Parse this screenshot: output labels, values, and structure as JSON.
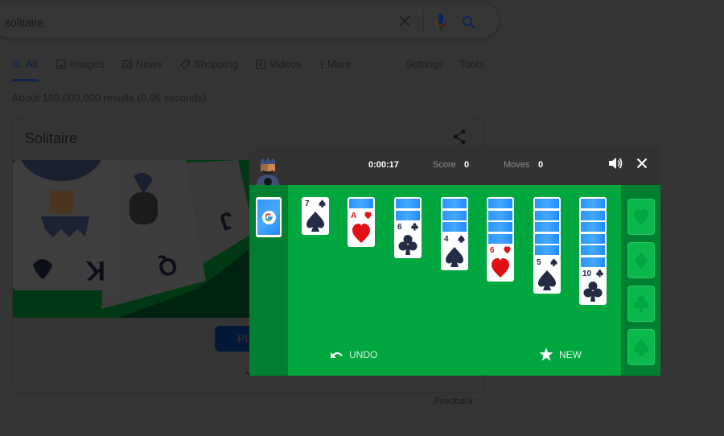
{
  "search": {
    "query": "solitaire",
    "clear_icon": "close-icon",
    "mic_icon": "microphone-icon",
    "search_icon": "search-icon"
  },
  "tabs": [
    {
      "label": "All",
      "icon": "search-icon",
      "active": true
    },
    {
      "label": "Images",
      "icon": "image-icon"
    },
    {
      "label": "News",
      "icon": "newspaper-icon"
    },
    {
      "label": "Shopping",
      "icon": "tag-icon"
    },
    {
      "label": "Videos",
      "icon": "play-icon"
    },
    {
      "label": "More",
      "icon": "more-vert-icon"
    },
    {
      "label": "Settings"
    },
    {
      "label": "Tools"
    }
  ],
  "result_stats": "About 169,000,000 results (0.96 seconds)",
  "knowledge_panel": {
    "title": "Solitaire",
    "play_button": "Play",
    "share_icon": "share-icon",
    "expand_icon": "chevron-down-icon"
  },
  "feedback": "Feedback",
  "game": {
    "timer": "0:00:17",
    "score_label": "Score",
    "score": "0",
    "moves_label": "Moves",
    "moves": "0",
    "undo_label": "UNDO",
    "new_label": "NEW",
    "colors": {
      "felt": "#00a63e",
      "side_strip": "#007f31",
      "card_back": "#2796ff",
      "black_suit": "#232b45",
      "red_suit": "#e20f15"
    },
    "tableau": [
      {
        "face_down": 0,
        "rank": "7",
        "suit": "spade",
        "color": "black"
      },
      {
        "face_down": 1,
        "rank": "A",
        "suit": "heart",
        "color": "red"
      },
      {
        "face_down": 2,
        "rank": "6",
        "suit": "club",
        "color": "black"
      },
      {
        "face_down": 3,
        "rank": "4",
        "suit": "spade",
        "color": "black"
      },
      {
        "face_down": 4,
        "rank": "6",
        "suit": "heart",
        "color": "red"
      },
      {
        "face_down": 5,
        "rank": "5",
        "suit": "spade",
        "color": "black"
      },
      {
        "face_down": 6,
        "rank": "10",
        "suit": "club",
        "color": "black"
      }
    ],
    "foundations": [
      "heart",
      "diamond",
      "club",
      "spade"
    ]
  }
}
